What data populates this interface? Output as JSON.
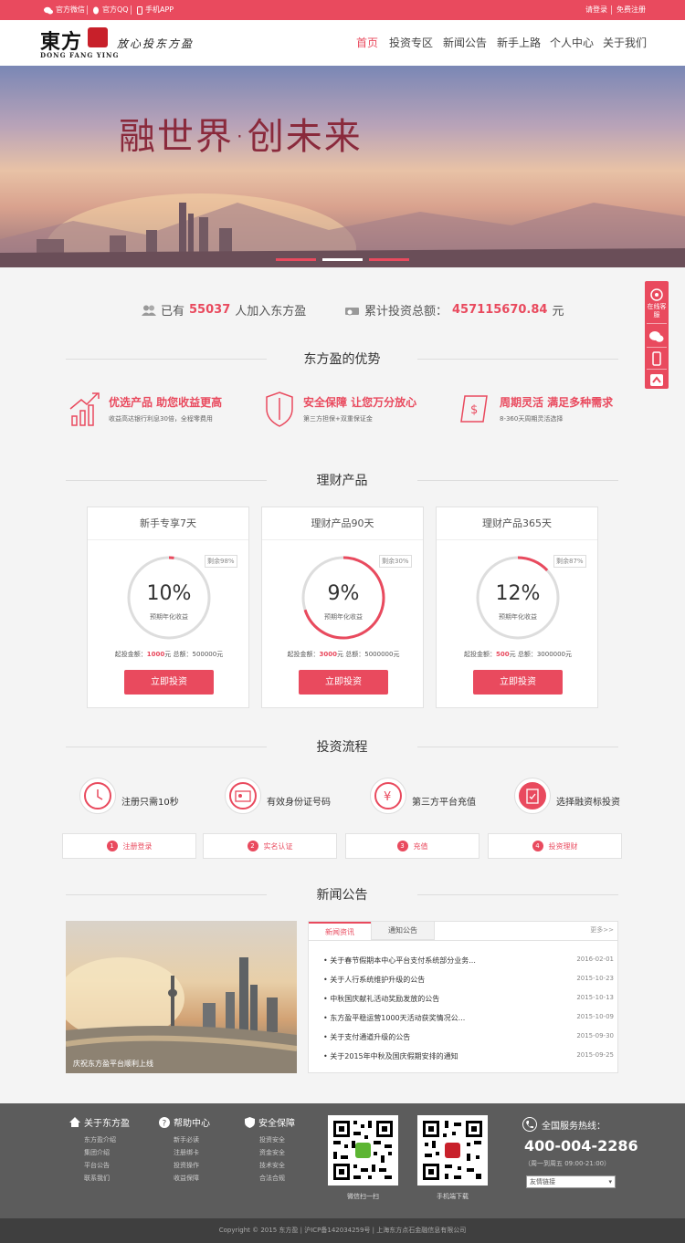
{
  "topbar": {
    "wechat": "官方微信",
    "qq": "官方QQ",
    "app": "手机APP",
    "login": "请登录",
    "register": "免费注册"
  },
  "logo": {
    "main": "東方",
    "sub": "DONG FANG YING",
    "slogan": "放心投东方盈"
  },
  "nav": [
    "首页",
    "投资专区",
    "新闻公告",
    "新手上路",
    "个人中心",
    "关于我们"
  ],
  "banner": {
    "title": "融世界·创未来"
  },
  "stats": {
    "joined_pre": "已有",
    "joined_count": "55037",
    "joined_post": "人加入东方盈",
    "invest_pre": "累计投资总额：",
    "invest_amount": "457115670.84",
    "invest_post": "元"
  },
  "sidebar": {
    "service": "在线客服"
  },
  "advantages": {
    "title": "东方盈的优势",
    "items": [
      {
        "title": "优选产品 助您收益更高",
        "desc": "收益高达银行利息30倍，全程零费用"
      },
      {
        "title": "安全保障 让您万分放心",
        "desc": "第三方担保+双重保证金"
      },
      {
        "title": "周期灵活 满足多种需求",
        "desc": "8-360天周期灵活选择"
      }
    ]
  },
  "products": {
    "title": "理财产品",
    "rate_label": "预期年化收益",
    "amount_label": "起投金额：",
    "amount_unit": "元",
    "total_label": "总额：",
    "button": "立即投资",
    "items": [
      {
        "name": "新手专享7天",
        "rate": "10%",
        "remain": "剩余98%",
        "progress": 0.02,
        "min": "1000",
        "total": "500000元"
      },
      {
        "name": "理财产品90天",
        "rate": "9%",
        "remain": "剩余30%",
        "progress": 0.7,
        "min": "3000",
        "total": "5000000元"
      },
      {
        "name": "理财产品365天",
        "rate": "12%",
        "remain": "剩余87%",
        "progress": 0.13,
        "min": "500",
        "total": "3000000元"
      }
    ]
  },
  "process": {
    "title": "投资流程",
    "steps": [
      "注册只需10秒",
      "有效身份证号码",
      "第三方平台充值",
      "选择融资标投资"
    ],
    "boxes": [
      {
        "num": "1",
        "label": "注册登录"
      },
      {
        "num": "2",
        "label": "实名认证"
      },
      {
        "num": "3",
        "label": "充值"
      },
      {
        "num": "4",
        "label": "投资理财"
      }
    ]
  },
  "news": {
    "title": "新闻公告",
    "image_caption": "庆祝东方盈平台顺利上线",
    "tabs": [
      "新闻资讯",
      "通知公告"
    ],
    "more": "更多>>",
    "items": [
      {
        "title": "关于春节假期本中心平台支付系统部分业务...",
        "date": "2016-02-01"
      },
      {
        "title": "关于人行系统维护升级的公告",
        "date": "2015-10-23"
      },
      {
        "title": "中秋国庆献礼活动奖励发放的公告",
        "date": "2015-10-13"
      },
      {
        "title": "东方盈平稳运营1000天活动获奖情况公...",
        "date": "2015-10-09"
      },
      {
        "title": "关于支付通道升级的公告",
        "date": "2015-09-30"
      },
      {
        "title": "关于2015年中秋及国庆假期安排的通知",
        "date": "2015-09-25"
      }
    ]
  },
  "footer": {
    "cols": [
      {
        "title": "关于东方盈",
        "links": [
          "东方盈介绍",
          "集团介绍",
          "平台公告",
          "联系我们"
        ]
      },
      {
        "title": "帮助中心",
        "links": [
          "新手必读",
          "注册绑卡",
          "投资操作",
          "收益保障"
        ]
      },
      {
        "title": "安全保障",
        "links": [
          "投资安全",
          "资金安全",
          "技术安全",
          "合法合规"
        ]
      }
    ],
    "qr_wechat": "微信扫一扫",
    "qr_app": "手机端下载",
    "hotline_label": "全国服务热线：",
    "hotline": "400-004-2286",
    "hours": "（周一到周五 09:00-21:00）",
    "links_select": "友情链接",
    "copyright": "Copyright © 2015 东方盈 | 沪ICP备142034259号 | 上海东方点石金融信息有限公司"
  },
  "colors": {
    "brand": "#e94a5e",
    "footer": "#5c5c5c"
  }
}
